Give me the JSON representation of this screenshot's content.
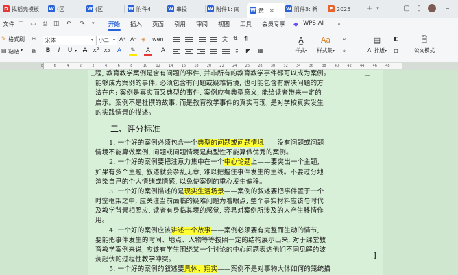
{
  "tabs": [
    {
      "label": "找稻壳模板",
      "icon": "D",
      "color": "#e53935"
    },
    {
      "label": "(区",
      "icon": "W",
      "color": "#2a62d8"
    },
    {
      "label": "(区",
      "icon": "W",
      "color": "#2a62d8"
    },
    {
      "label": "附件4",
      "icon": "W",
      "color": "#2a62d8"
    },
    {
      "label": "串投",
      "icon": "W",
      "color": "#2a62d8"
    },
    {
      "label": "附件1: 南",
      "icon": "W",
      "color": "#2a62d8"
    },
    {
      "label": "黄",
      "icon": "W",
      "color": "#2a62d8"
    },
    {
      "label": "附件3: 新",
      "icon": "W",
      "color": "#2a62d8"
    },
    {
      "label": "2025",
      "icon": "P",
      "color": "#e8622b"
    }
  ],
  "menu": {
    "file": "文件",
    "items": [
      "开始",
      "插入",
      "页面",
      "引用",
      "审阅",
      "视图",
      "工具",
      "会员专享"
    ],
    "active": "开始",
    "ai": "WPS AI"
  },
  "ribbon": {
    "format_painter": "格式刷",
    "paste": "粘贴",
    "font_name": "宋体",
    "font_size": "小二",
    "styles": "样式",
    "style_set": "样式集",
    "ai_format": "AI 排版",
    "official": "公文模式"
  },
  "ruler_ticks": [
    "8",
    "6",
    "4",
    "2",
    "2",
    "4",
    "6",
    "8",
    "10",
    "12",
    "14",
    "16",
    "18",
    "20",
    "22",
    "24",
    "26",
    "28",
    "30",
    "32",
    "34",
    "36",
    "38",
    "40",
    "42",
    "44",
    "46",
    "48"
  ],
  "doc": {
    "p0": [
      "程, 教育教学案例是含有问题的事件, 并非所有的教育教学事件都可以成为案例。",
      "能够成为案例的事件, 必须包含有问题或疑难情境, 也可能包含有解决问题的方",
      "法在内; 案例是真实而又典型的事件, 案例应有典型意义, 能给读者带来一定的",
      "启示。案例不是杜撰的故事, 而是教育教学事件的真实再现, 是对学校真实发生",
      "的实践情景的描述。"
    ],
    "heading": "二、评分标准",
    "p1": {
      "a": "1. 一个好的案例必须包含一个",
      "hl": "典型的问题或问题情境",
      "b": "——没有问题或问题",
      "rest": [
        "情境不能算做案例, 问题或问题情境是典型性不能算做优秀的案例。"
      ]
    },
    "p2": {
      "a": "2. 一个好的案例要把注意力集中在一个",
      "hl": "中心论题",
      "b": "上——要突出一个主题,",
      "rest": [
        "如果有多个主题, 叙述就会杂乱无章, 难以把握住事件发生的主线。不要过分地",
        "渲染自己的个人情绪或情感, 以免使案例的重心发生偏移。"
      ]
    },
    "p3": {
      "a": "3. 一个好的案例描述的是",
      "hl": "现实生活场景",
      "b": "——案例的叙述要把事件置于一个",
      "rest": [
        "时空框架之中, 应关注当前面临的疑难问题为着眼点, 整个事实材料应该与时代",
        "及教学背景相照应, 读者有身临其境的感觉, 容易对案例所涉及的人产生移情作",
        "用。"
      ]
    },
    "p4": {
      "a": "4. 一个好的案例应该",
      "hl": "讲述一个故事",
      "b": "——案例必须要有完整而生动的情节,",
      "rest": [
        "要能把事件发生的时间、地点、人物等等按照一定的结构展示出来, 对于课堂教",
        "育教学案例来说, 应该有学生围绕某一个讨论的中心问题表达他们不同见解的波",
        "澜起伏的过程性教学冲突。"
      ]
    },
    "p5": {
      "a": "5. 一个好的案例的叙述要",
      "hl": "具体、翔实",
      "b": "——案例不是对事物大体如何的笼统描"
    }
  }
}
